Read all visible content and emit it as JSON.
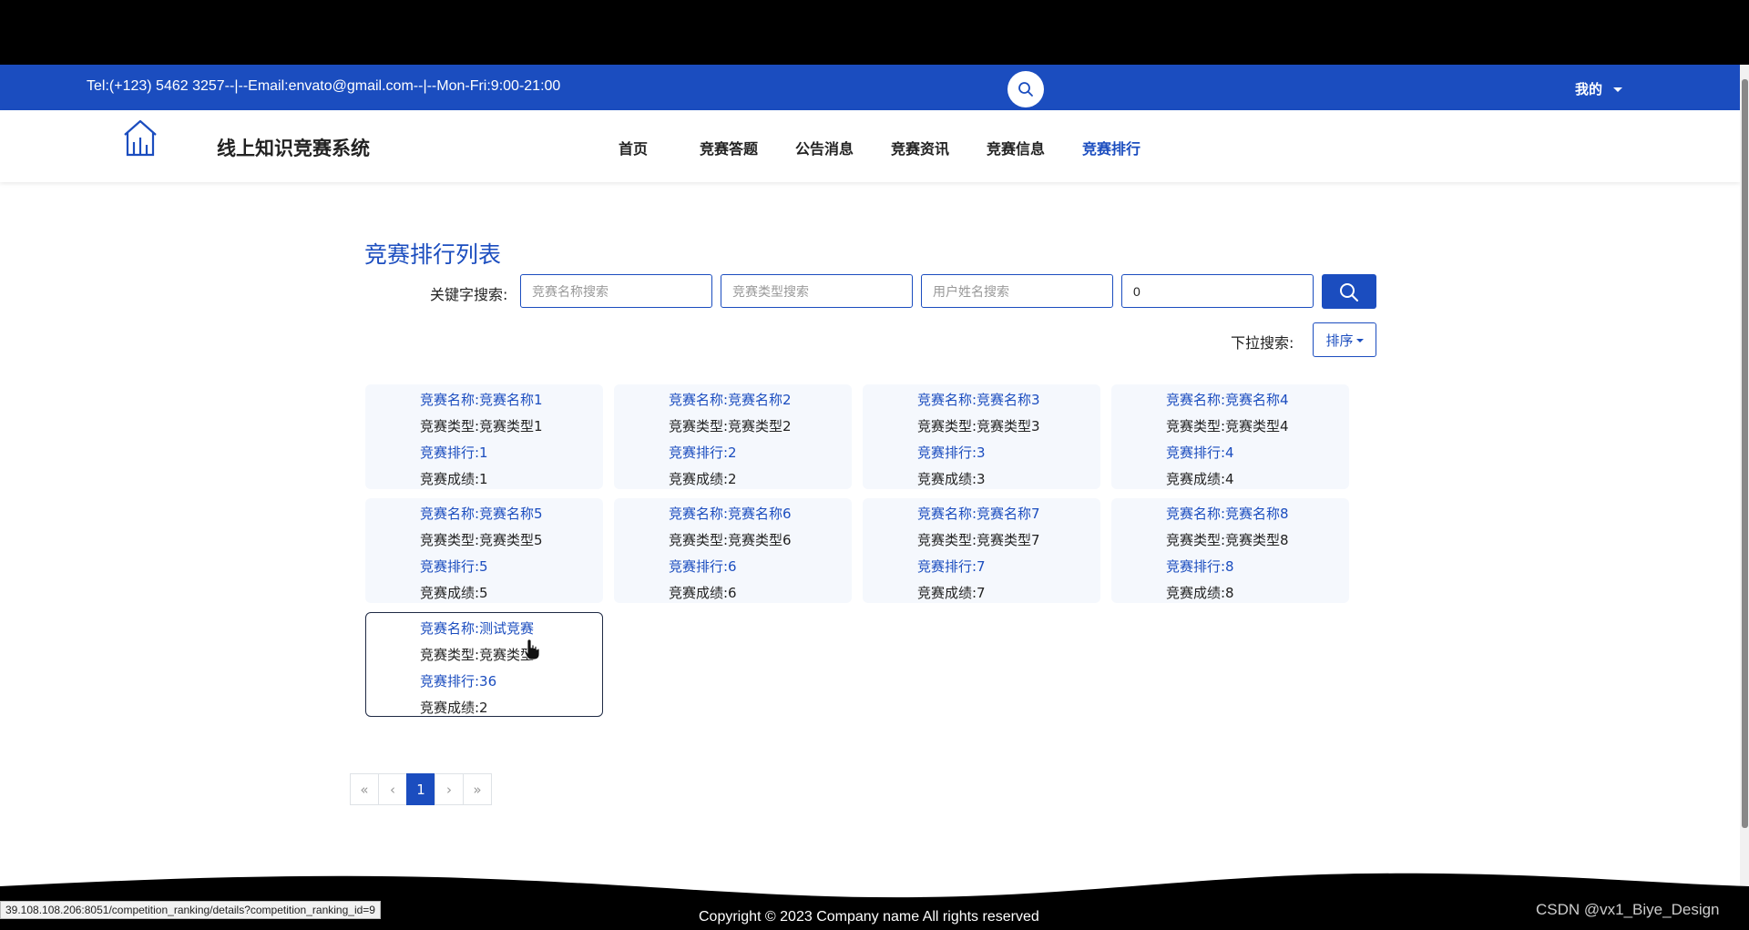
{
  "topbar": {
    "contact": "Tel:(+123) 5462 3257--|--Email:envato@gmail.com--|--Mon-Fri:9:00-21:00",
    "search_icon": "search-icon",
    "user_menu_label": "我的"
  },
  "header": {
    "site_title": "线上知识竞赛系统",
    "logo_icon": "building-chart-icon",
    "nav": [
      "首页",
      "竞赛答题",
      "公告消息",
      "竞赛资讯",
      "竞赛信息",
      "竞赛排行"
    ],
    "active_nav": "竞赛排行"
  },
  "main": {
    "title": "竞赛排行列表",
    "keyword_label": "关键字搜索:",
    "fields": [
      {
        "placeholder": "竞赛名称搜索",
        "value": ""
      },
      {
        "placeholder": "竞赛类型搜索",
        "value": ""
      },
      {
        "placeholder": "用户姓名搜索",
        "value": ""
      },
      {
        "placeholder": "",
        "value": "0"
      }
    ],
    "dropdown_label": "下拉搜索:",
    "sort_label": "排序",
    "cards": [
      {
        "name": "竞赛名称:竞赛名称1",
        "type": "竞赛类型:竞赛类型1",
        "rank": "竞赛排行:1",
        "score": "竞赛成绩:1"
      },
      {
        "name": "竞赛名称:竞赛名称2",
        "type": "竞赛类型:竞赛类型2",
        "rank": "竞赛排行:2",
        "score": "竞赛成绩:2"
      },
      {
        "name": "竞赛名称:竞赛名称3",
        "type": "竞赛类型:竞赛类型3",
        "rank": "竞赛排行:3",
        "score": "竞赛成绩:3"
      },
      {
        "name": "竞赛名称:竞赛名称4",
        "type": "竞赛类型:竞赛类型4",
        "rank": "竞赛排行:4",
        "score": "竞赛成绩:4"
      },
      {
        "name": "竞赛名称:竞赛名称5",
        "type": "竞赛类型:竞赛类型5",
        "rank": "竞赛排行:5",
        "score": "竞赛成绩:5"
      },
      {
        "name": "竞赛名称:竞赛名称6",
        "type": "竞赛类型:竞赛类型6",
        "rank": "竞赛排行:6",
        "score": "竞赛成绩:6"
      },
      {
        "name": "竞赛名称:竞赛名称7",
        "type": "竞赛类型:竞赛类型7",
        "rank": "竞赛排行:7",
        "score": "竞赛成绩:7"
      },
      {
        "name": "竞赛名称:竞赛名称8",
        "type": "竞赛类型:竞赛类型8",
        "rank": "竞赛排行:8",
        "score": "竞赛成绩:8"
      },
      {
        "name": "竞赛名称:测试竞赛",
        "type": "竞赛类型:竞赛类型",
        "rank": "竞赛排行:36",
        "score": "竞赛成绩:2"
      }
    ],
    "pagination": {
      "first": "«",
      "prev": "‹",
      "current": "1",
      "next": "›",
      "last": "»"
    }
  },
  "footer": {
    "copyright": "Copyright © 2023 Company name All rights reserved"
  },
  "browser": {
    "status_url": "39.108.108.206:8051/competition_ranking/details?competition_ranking_id=9",
    "watermark": "CSDN @vx1_Biye_Design"
  },
  "colors": {
    "primary": "#1b4dbf",
    "card_bg": "#f5f8fd",
    "footer": "#000000"
  }
}
